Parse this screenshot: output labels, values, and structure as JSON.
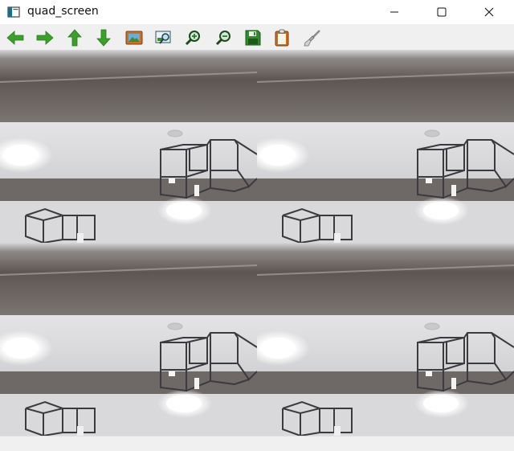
{
  "window": {
    "title": "quad_screen",
    "controls": [
      "minimize",
      "maximize",
      "close"
    ]
  },
  "toolbar": {
    "buttons": [
      {
        "name": "pan-left",
        "icon": "arrow-left-icon"
      },
      {
        "name": "pan-right",
        "icon": "arrow-right-icon"
      },
      {
        "name": "pan-up",
        "icon": "arrow-up-icon"
      },
      {
        "name": "pan-down",
        "icon": "arrow-down-icon"
      },
      {
        "name": "zoom-image",
        "icon": "image-icon"
      },
      {
        "name": "zoom-region",
        "icon": "zoom-region-icon"
      },
      {
        "name": "zoom-in",
        "icon": "zoom-in-icon"
      },
      {
        "name": "zoom-out",
        "icon": "zoom-out-icon"
      },
      {
        "name": "save",
        "icon": "save-icon"
      },
      {
        "name": "copy",
        "icon": "clipboard-icon"
      },
      {
        "name": "properties",
        "icon": "brush-icon"
      }
    ]
  },
  "view": {
    "layout": "2x2",
    "quadrants": [
      "top-left",
      "top-right",
      "bottom-left",
      "bottom-right"
    ]
  },
  "colors": {
    "arrow_green": "#3aa02a",
    "title_bg": "#ffffff",
    "toolbar_bg": "#f0f0f0"
  }
}
